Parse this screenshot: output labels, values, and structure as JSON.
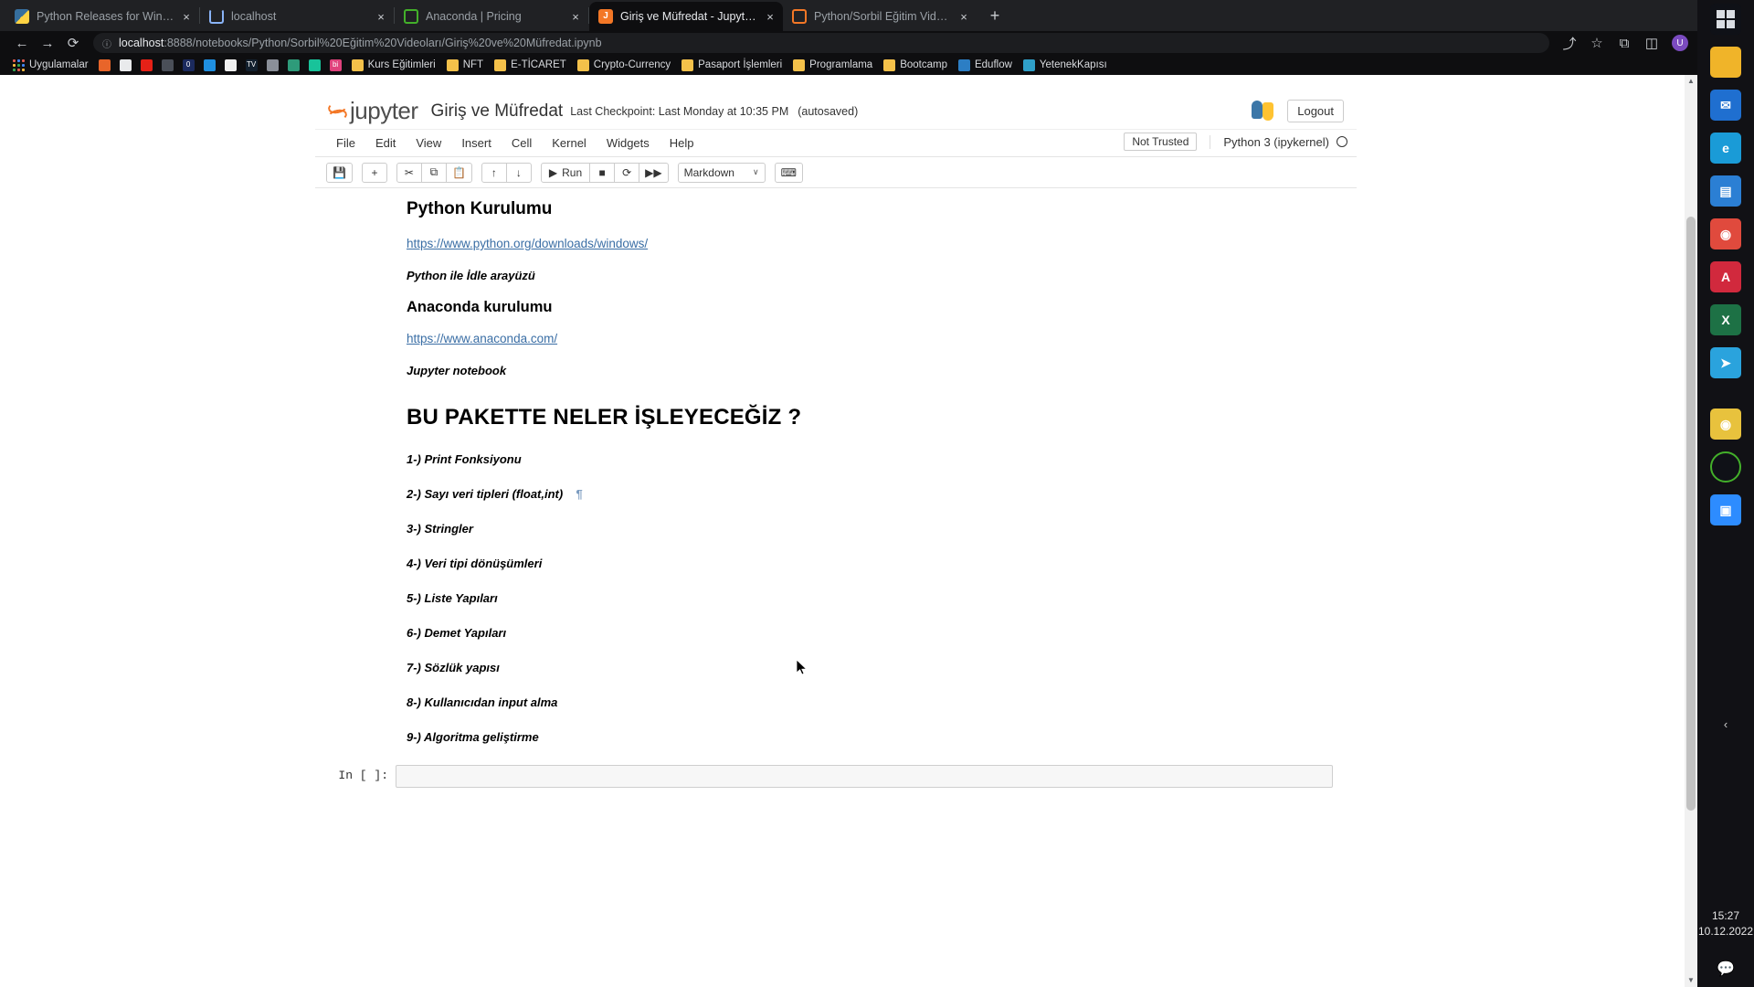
{
  "browser": {
    "tabs": [
      {
        "title": "Python Releases for Windows | P",
        "icon": "python-icon",
        "active": false,
        "close": "×"
      },
      {
        "title": "localhost",
        "icon": "loading-spinner-icon",
        "active": false,
        "close": "×"
      },
      {
        "title": "Anaconda | Pricing",
        "icon": "anaconda-icon",
        "active": false,
        "close": "×"
      },
      {
        "title": "Giriş ve Müfredat - Jupyter Note",
        "icon": "jupyter-icon",
        "active": true,
        "close": "×"
      },
      {
        "title": "Python/Sorbil Eğitim Videoları/",
        "icon": "anaconda-icon",
        "active": false,
        "close": "×"
      }
    ],
    "new_tab_label": "+",
    "nav": {
      "back": "←",
      "forward": "→",
      "reload": "⟳",
      "site_info": "ⓘ",
      "url_host": "localhost",
      "url_rest": ":8888/notebooks/Python/Sorbil%20Eğitim%20Videoları/Giriş%20ve%20Müfredat.ipynb",
      "share": "⤴",
      "bookmark_star": "☆",
      "extensions": "⧉",
      "sidepanel": "◫",
      "avatar_initial": "U"
    },
    "bookmarks": [
      {
        "label": "Uygulamalar",
        "icon": "apps-grid-icon"
      },
      {
        "label": "",
        "icon": "firefox-icon"
      },
      {
        "label": "",
        "icon": "cloud-icon"
      },
      {
        "label": "",
        "icon": "youtube-icon"
      },
      {
        "label": "",
        "icon": "chart-icon"
      },
      {
        "label": "",
        "icon": "zero-icon"
      },
      {
        "label": "",
        "icon": "photos-icon"
      },
      {
        "label": "",
        "icon": "ghost-icon"
      },
      {
        "label": "",
        "icon": "tv-icon"
      },
      {
        "label": "",
        "icon": "tv2-icon"
      },
      {
        "label": "",
        "icon": "grid-icon"
      },
      {
        "label": "",
        "icon": "mountain-icon"
      },
      {
        "label": "",
        "icon": "bi-icon"
      },
      {
        "label": "Kurs Eğitimleri",
        "icon": "folder-icon"
      },
      {
        "label": "NFT",
        "icon": "folder-icon"
      },
      {
        "label": "E-TİCARET",
        "icon": "folder-icon"
      },
      {
        "label": "Crypto-Currency",
        "icon": "folder-icon"
      },
      {
        "label": "Pasaport İşlemleri",
        "icon": "folder-icon"
      },
      {
        "label": "Programlama",
        "icon": "folder-icon"
      },
      {
        "label": "Bootcamp",
        "icon": "folder-icon"
      },
      {
        "label": "Eduflow",
        "icon": "eduflow-icon"
      },
      {
        "label": "YetenekKapısı",
        "icon": "yetenek-icon"
      }
    ]
  },
  "jupyter": {
    "logo_text": "jupyter",
    "notebook_title": "Giriş ve Müfredat",
    "checkpoint": "Last Checkpoint: Last Monday at 10:35 PM",
    "autosaved": "(autosaved)",
    "logout_label": "Logout",
    "menu": [
      "File",
      "Edit",
      "View",
      "Insert",
      "Cell",
      "Kernel",
      "Widgets",
      "Help"
    ],
    "trust_status": "Not Trusted",
    "kernel_name": "Python 3 (ipykernel)",
    "toolbar": {
      "save": "💾",
      "insert_below": "+",
      "cut": "✂",
      "copy": "⧉",
      "paste": "📋",
      "move_up": "↑",
      "move_down": "↓",
      "run_label": "Run",
      "run_icon": "▶",
      "interrupt": "■",
      "restart": "⟳",
      "restart_run_all": "▶▶",
      "cell_type": "Markdown",
      "cell_type_caret": "∨",
      "command_palette": "⌨"
    }
  },
  "notebook": {
    "heading_python_kurulumu": "Python Kurulumu",
    "link_python": "https://www.python.org/downloads/windows/",
    "sub_idle": "Python ile İdle arayüzü",
    "heading_anaconda": "Anaconda kurulumu",
    "link_anaconda": "https://www.anaconda.com/",
    "sub_jupyter": "Jupyter notebook",
    "heading_main": "BU PAKETTE NELER İŞLEYECEĞİZ ?",
    "pilcrow": "¶",
    "items": [
      "1-) Print Fonksiyonu",
      "2-) Sayı veri tipleri (float,int)",
      "3-) Stringler",
      "4-) Veri tipi dönüşümleri",
      "5-) Liste Yapıları",
      "6-) Demet Yapıları",
      "7-) Sözlük yapısı",
      "8-) Kullanıcıdan input alma",
      "9-) Algoritma geliştirme"
    ],
    "in_prompt": "In [ ]:",
    "input_value": ""
  },
  "taskbar": {
    "icons": [
      {
        "name": "start-windows-icon",
        "glyph": "⊞",
        "color": "#2a82da"
      },
      {
        "name": "file-explorer-icon",
        "glyph": "📁",
        "color": "#e8b24a"
      },
      {
        "name": "mail-icon",
        "glyph": "✉",
        "color": "#1f6fd0"
      },
      {
        "name": "edge-icon",
        "glyph": "e",
        "color": "#1a9bd7"
      },
      {
        "name": "store-icon",
        "glyph": "🛍",
        "color": "#2b7fd4"
      },
      {
        "name": "chrome-icon",
        "glyph": "◉",
        "color": "#e04a3d"
      },
      {
        "name": "pdf-reader-icon",
        "glyph": "A",
        "color": "#d1293d"
      },
      {
        "name": "excel-icon",
        "glyph": "X",
        "color": "#1d7145"
      },
      {
        "name": "telegram-icon",
        "glyph": "➤",
        "color": "#2aa3dd"
      },
      {
        "name": "chrome-active-icon",
        "glyph": "◉",
        "color": "#e8c23d"
      },
      {
        "name": "anaconda-icon",
        "glyph": "◯",
        "color": "#43b02a"
      },
      {
        "name": "zoom-icon",
        "glyph": "▣",
        "color": "#2d8cff"
      }
    ],
    "collapse_arrow": "‹",
    "time": "15:27",
    "date": "10.12.2022",
    "notification_icon": "💬"
  }
}
